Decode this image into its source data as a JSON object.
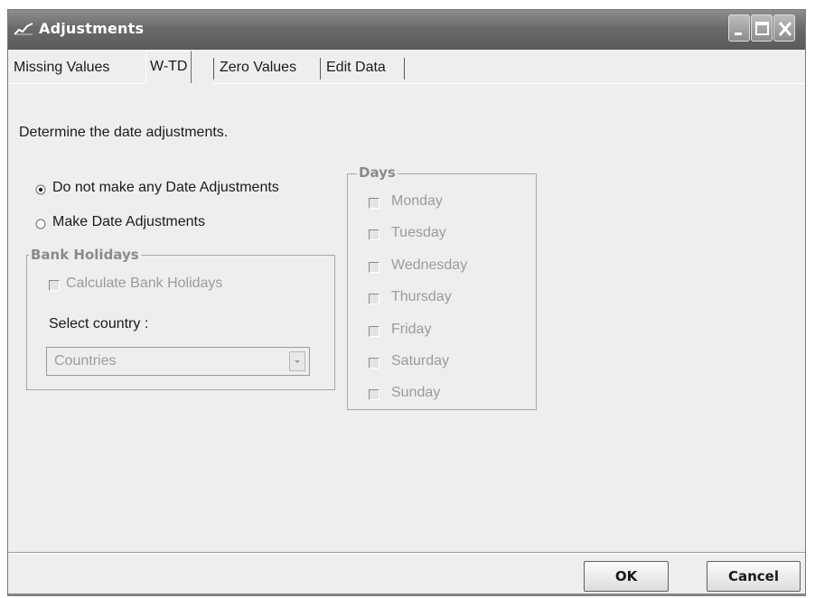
{
  "window": {
    "title": "Adjustments",
    "app_icon": "chart-line-icon",
    "controls": [
      "minimize-icon",
      "maximize-icon",
      "close-icon"
    ]
  },
  "tabs": [
    {
      "label": "Missing Values",
      "active": false
    },
    {
      "label": "W-TD",
      "active": true
    },
    {
      "label": "Zero Values",
      "active": false
    },
    {
      "label": "Edit Data",
      "active": false
    }
  ],
  "panel": {
    "instruction": "Determine the date adjustments.",
    "radio_options": [
      {
        "label": "Do not make any Date Adjustments",
        "selected": true
      },
      {
        "label": "Make Date Adjustments",
        "selected": false
      }
    ],
    "bank_holidays": {
      "title": "Bank Holidays",
      "checkbox_label": "Calculate Bank Holidays",
      "checked": false,
      "select_label": "Select country :",
      "select_value": "Countries"
    },
    "days": {
      "title": "Days",
      "items": [
        "Monday",
        "Tuesday",
        "Wednesday",
        "Thursday",
        "Friday",
        "Saturday",
        "Sunday"
      ]
    }
  },
  "buttons": {
    "ok": "OK",
    "cancel": "Cancel"
  }
}
